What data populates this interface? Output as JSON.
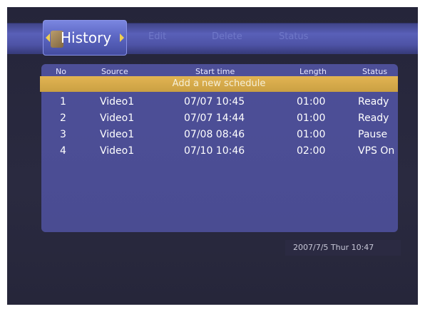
{
  "tabs": {
    "active_label": "History",
    "edit_label": "Edit",
    "delete_label": "Delete",
    "status_label": "Status"
  },
  "table": {
    "headers": {
      "no": "No",
      "source": "Source",
      "start_time": "Start time",
      "length": "Length",
      "status": "Status"
    },
    "add_schedule_label": "Add a new schedule",
    "rows": [
      {
        "no": "1",
        "source": "Video1",
        "start_time": "07/07 10:45",
        "length": "01:00",
        "status": "Ready"
      },
      {
        "no": "2",
        "source": "Video1",
        "start_time": "07/07 14:44",
        "length": "01:00",
        "status": "Ready"
      },
      {
        "no": "3",
        "source": "Video1",
        "start_time": "07/08 08:46",
        "length": "01:00",
        "status": "Pause"
      },
      {
        "no": "4",
        "source": "Video1",
        "start_time": "07/10 10:46",
        "length": "02:00",
        "status": "VPS On"
      }
    ]
  },
  "footer": {
    "datetime": "2007/7/5 Thur 10:47"
  },
  "colors": {
    "band": "#5960b8",
    "panel": "#4d4f98",
    "highlight": "#e2b452",
    "arrow": "#f0d050"
  },
  "icons": [
    "history-tab-icon",
    "left-arrow-icon",
    "right-arrow-icon"
  ]
}
